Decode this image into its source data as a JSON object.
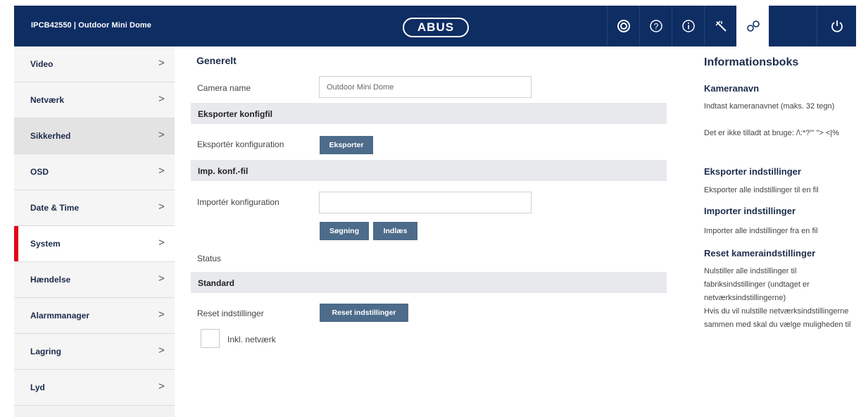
{
  "header": {
    "camera_title": "IPCB42550 | Outdoor Mini Dome",
    "logo": "ABUS",
    "buttons": [
      {
        "name": "camera-icon",
        "glyph": "◉"
      },
      {
        "name": "help-icon",
        "glyph": "?"
      },
      {
        "name": "info-icon",
        "glyph": "ⓘ"
      },
      {
        "name": "wizard-icon",
        "glyph": "✎"
      },
      {
        "name": "settings-icon",
        "glyph": "⚙"
      },
      {
        "name": "power-icon",
        "glyph": "⏻"
      }
    ]
  },
  "sidebar": {
    "items": [
      {
        "label": "Video",
        "chevron": ">"
      },
      {
        "label": "Netværk",
        "chevron": ">"
      },
      {
        "label": "Sikkerhed",
        "chevron": ">"
      },
      {
        "label": "OSD",
        "chevron": ">"
      },
      {
        "label": "Date & Time",
        "chevron": ">"
      },
      {
        "label": "System",
        "chevron": ">"
      },
      {
        "label": "Hændelse",
        "chevron": ">"
      },
      {
        "label": "Alarmmanager",
        "chevron": ">"
      },
      {
        "label": "Lagring",
        "chevron": ">"
      },
      {
        "label": "Lyd",
        "chevron": ">"
      }
    ],
    "active_index": 5
  },
  "main": {
    "section_title": "Generelt",
    "camera_name_label": "Camera name",
    "camera_name_value": "Outdoor Mini Dome",
    "export_band": "Eksporter konfigfil",
    "export_label": "Eksportér konfiguration",
    "export_button": "Eksporter",
    "import_band": "Imp. konf.-fil",
    "import_label": "Importér konfiguration",
    "import_value": "",
    "search_button": "Søgning",
    "load_button": "Indlæs",
    "status_label": "Status",
    "standard_band": "Standard",
    "reset_label": "Reset indstillinger",
    "reset_button": "Reset indstillinger",
    "incl_network_label": "Inkl. netværk"
  },
  "info": {
    "title": "Informationsboks",
    "camera_name_heading": "Kameranavn",
    "camera_name_text": "Indtast kameranavnet (maks. 32 tegn)",
    "camera_name_text2": "Det er ikke tilladt at bruge: /\\:*?'\" \"> <|%",
    "export_heading": "Eksporter indstillinger",
    "export_text": "Eksporter alle indstillinger til en fil",
    "import_heading": "Importer indstillinger",
    "import_text": "Importer alle indstillinger fra en fil",
    "reset_heading": "Reset kameraindstillinger",
    "reset_text": "Nulstiller alle indstillinger til fabriksindstillinger (undtaget er netværksindstillingerne)",
    "reset_text2": "Hvis du vil nulstille netværksindstillingerne sammen med skal du vælge muligheden til"
  },
  "colors": {
    "header_bg": "#0e2d63",
    "accent_red": "#e2001a",
    "button_bg": "#4d6b8a",
    "band_bg": "#e8e9ec"
  }
}
